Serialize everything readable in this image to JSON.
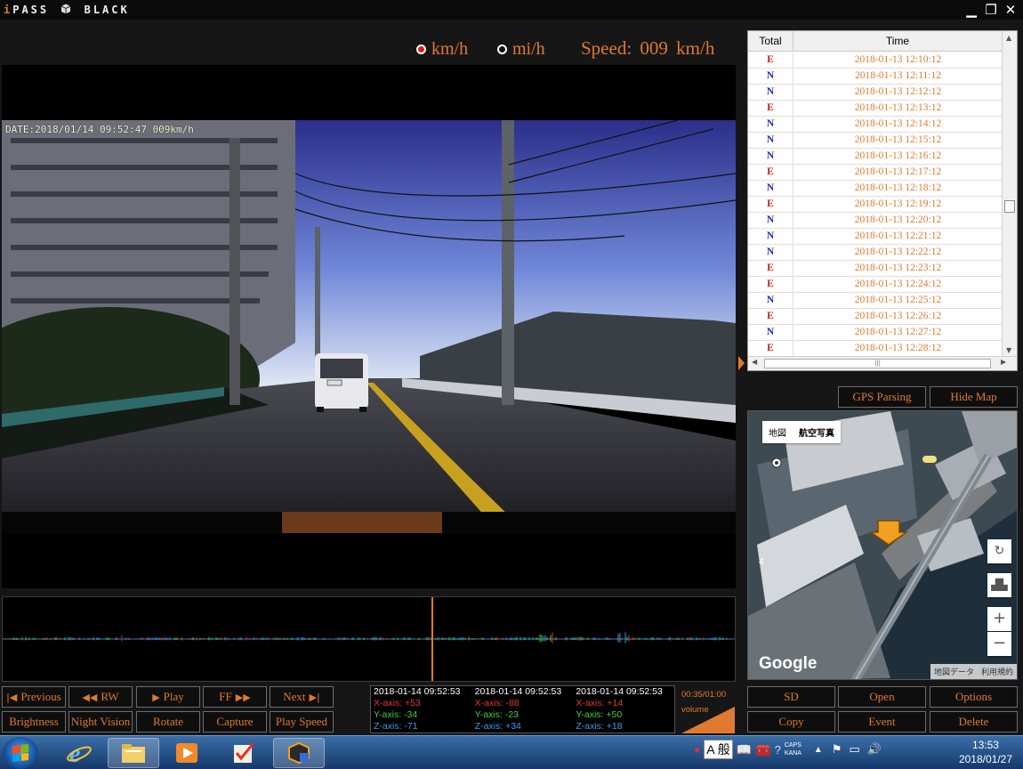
{
  "app": {
    "brand_i": "i",
    "brand_pass": "PASS",
    "brand_black": "BLACK"
  },
  "speed": {
    "unit_kmh": "km/h",
    "unit_mih": "mi/h",
    "selected_unit": "km/h",
    "label": "Speed:",
    "value": "009",
    "unit": "km/h"
  },
  "video": {
    "osd": "DATE:2018/01/14 09:52:47 009km/h"
  },
  "controls": {
    "previous": "Previous",
    "rw": "RW",
    "play": "Play",
    "ff": "FF",
    "next": "Next",
    "brightness": "Brightness",
    "night_vision": "Night Vision",
    "rotate": "Rotate",
    "capture": "Capture",
    "play_speed": "Play Speed"
  },
  "sensors": [
    {
      "timestamp": "2018-01-14 09:52:53",
      "x": "X-axis: +53",
      "y": "Y-axis: -34",
      "z": "Z-axis: -71"
    },
    {
      "timestamp": "2018-01-14 09:52:53",
      "x": "X-axis: -88",
      "y": "Y-axis: -23",
      "z": "Z-axis: +34"
    },
    {
      "timestamp": "2018-01-14 09:52:53",
      "x": "X-axis: +14",
      "y": "Y-axis: +50",
      "z": "Z-axis: +18"
    }
  ],
  "playback": {
    "time": "00:35/01:00",
    "volume_label": "volume",
    "volume_pct": "100%",
    "volume_level": 1.0
  },
  "events": {
    "headers": {
      "total": "Total",
      "time": "Time"
    },
    "rows": [
      {
        "type": "E",
        "time": "2018-01-13 12:10:12"
      },
      {
        "type": "N",
        "time": "2018-01-13 12:11:12"
      },
      {
        "type": "N",
        "time": "2018-01-13 12:12:12"
      },
      {
        "type": "E",
        "time": "2018-01-13 12:13:12"
      },
      {
        "type": "N",
        "time": "2018-01-13 12:14:12"
      },
      {
        "type": "N",
        "time": "2018-01-13 12:15:12"
      },
      {
        "type": "N",
        "time": "2018-01-13 12:16:12"
      },
      {
        "type": "E",
        "time": "2018-01-13 12:17:12"
      },
      {
        "type": "N",
        "time": "2018-01-13 12:18:12"
      },
      {
        "type": "E",
        "time": "2018-01-13 12:19:12"
      },
      {
        "type": "N",
        "time": "2018-01-13 12:20:12"
      },
      {
        "type": "N",
        "time": "2018-01-13 12:21:12"
      },
      {
        "type": "N",
        "time": "2018-01-13 12:22:12"
      },
      {
        "type": "E",
        "time": "2018-01-13 12:23:12"
      },
      {
        "type": "E",
        "time": "2018-01-13 12:24:12"
      },
      {
        "type": "N",
        "time": "2018-01-13 12:25:12"
      },
      {
        "type": "E",
        "time": "2018-01-13 12:26:12"
      },
      {
        "type": "N",
        "time": "2018-01-13 12:27:12"
      },
      {
        "type": "E",
        "time": "2018-01-13 12:28:12"
      }
    ]
  },
  "map": {
    "gps_parsing": "GPS Parsing",
    "hide_map": "Hide Map",
    "tab_map": "地図",
    "tab_satellite": "航空写真",
    "google": "Google",
    "map_data": "地図データ",
    "terms": "利用規約"
  },
  "right_buttons": {
    "sd": "SD",
    "open": "Open",
    "options": "Options",
    "copy": "Copy",
    "event": "Event",
    "delete": "Delete"
  },
  "taskbar": {
    "ime": "A 般",
    "caps": "CAPS",
    "kana": "KANA",
    "time": "13:53",
    "date": "2018/01/27"
  },
  "colors": {
    "accent": "#e07a2e",
    "event_E": "#d01818",
    "event_N": "#1a2fb8",
    "axis_x": "#e53535",
    "axis_y": "#3fd03f",
    "axis_z": "#3b9be5"
  },
  "icons": [
    "close-icon",
    "maximize-icon",
    "minimize-icon",
    "prev-icon",
    "rw-icon",
    "play-icon",
    "ff-icon",
    "next-icon",
    "rotate-map-icon",
    "tilt-map-icon",
    "zoom-in-icon",
    "zoom-out-icon",
    "car-position-icon"
  ]
}
